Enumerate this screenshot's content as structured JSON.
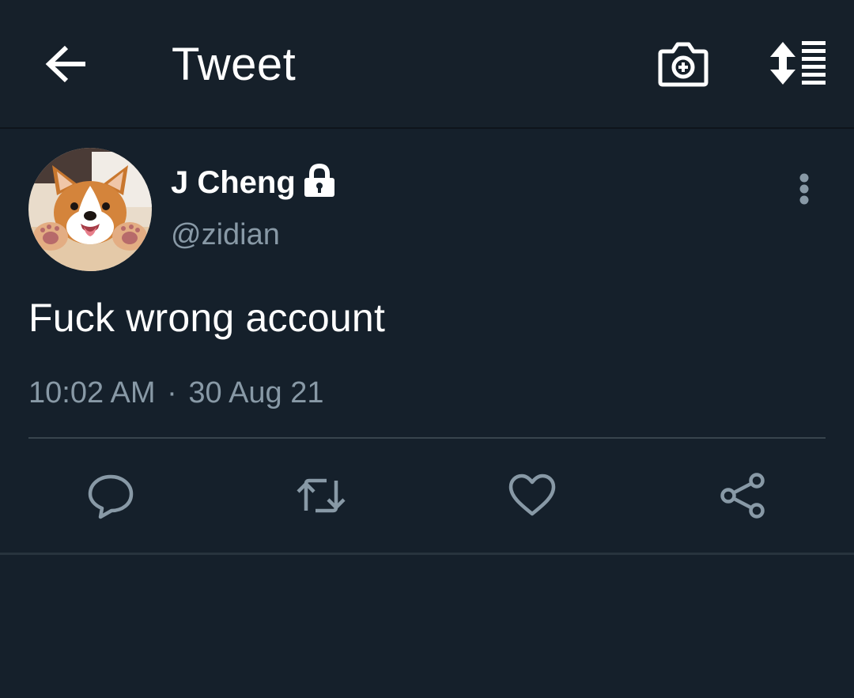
{
  "header": {
    "back_icon": "arrow-left-icon",
    "title": "Tweet",
    "camera_icon": "camera-plus-icon",
    "sort_icon": "sort-list-icon"
  },
  "tweet": {
    "author": {
      "display_name": "J Cheng",
      "handle": "@zidian",
      "protected": true,
      "avatar": "corgi-avatar"
    },
    "text": "Fuck wrong account",
    "time": "10:02 AM",
    "separator": "·",
    "date": "30 Aug 21"
  },
  "actions": [
    {
      "name": "reply",
      "icon": "reply-icon"
    },
    {
      "name": "retweet",
      "icon": "retweet-icon"
    },
    {
      "name": "like",
      "icon": "heart-icon"
    },
    {
      "name": "share",
      "icon": "share-icon"
    }
  ],
  "colors": {
    "background": "#15202b",
    "text_primary": "#ffffff",
    "text_secondary": "#8899a6",
    "icon_muted": "#8899a6",
    "divider": "#38444d"
  }
}
